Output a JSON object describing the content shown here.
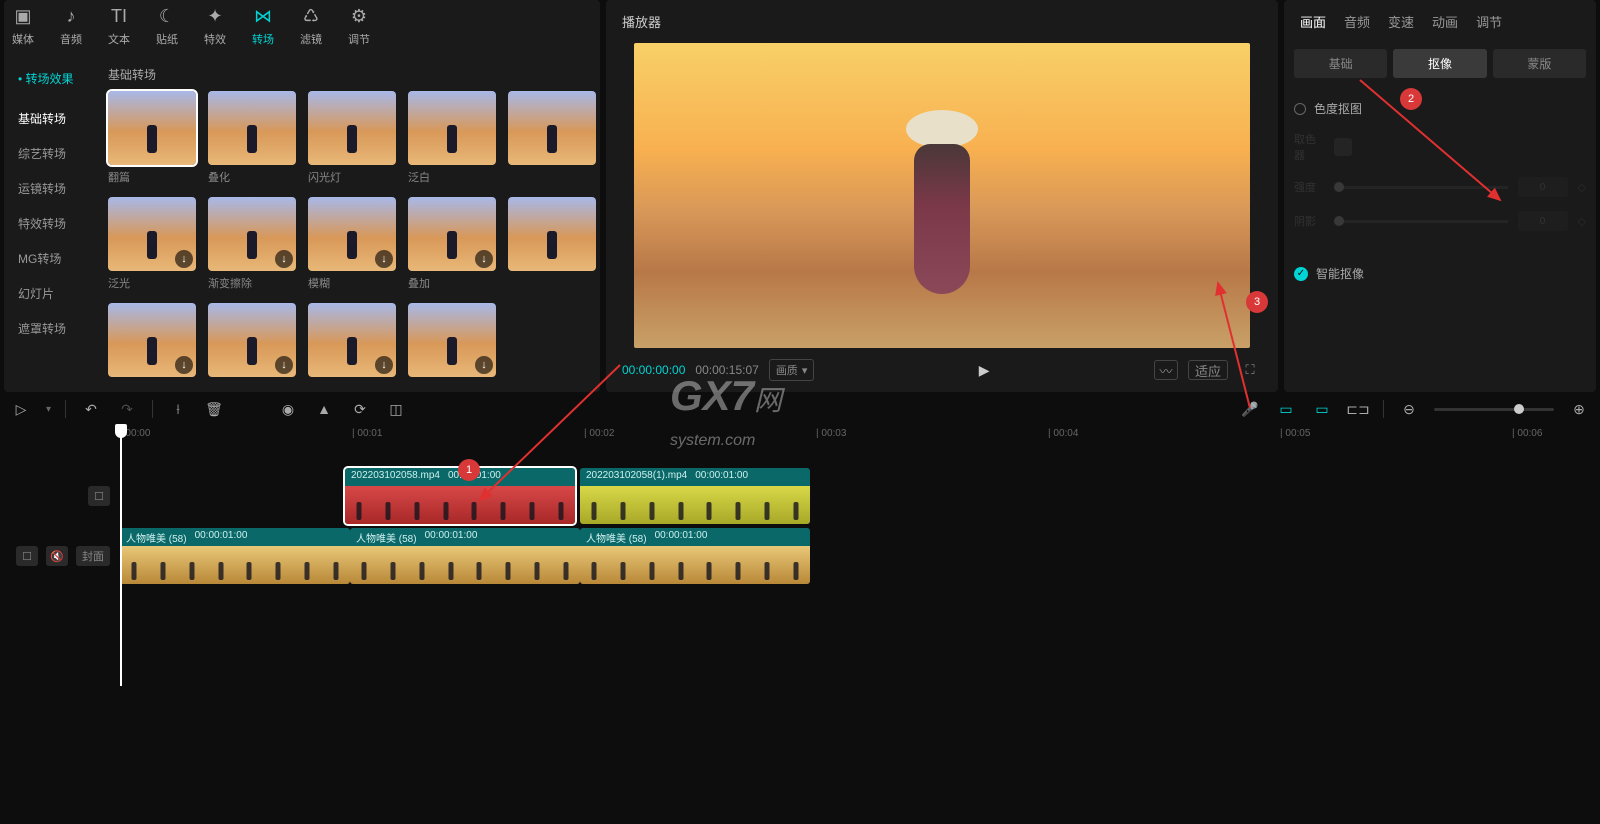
{
  "topTabs": [
    {
      "label": "媒体",
      "active": false
    },
    {
      "label": "音频",
      "active": false
    },
    {
      "label": "文本",
      "active": false
    },
    {
      "label": "贴纸",
      "active": false
    },
    {
      "label": "特效",
      "active": false
    },
    {
      "label": "转场",
      "active": true
    },
    {
      "label": "滤镜",
      "active": false
    },
    {
      "label": "调节",
      "active": false
    }
  ],
  "sideTitle": "转场效果",
  "sideCats": [
    {
      "label": "基础转场",
      "active": true
    },
    {
      "label": "综艺转场",
      "active": false
    },
    {
      "label": "运镜转场",
      "active": false
    },
    {
      "label": "特效转场",
      "active": false
    },
    {
      "label": "MG转场",
      "active": false
    },
    {
      "label": "幻灯片",
      "active": false
    },
    {
      "label": "遮罩转场",
      "active": false
    }
  ],
  "gridTitle": "基础转场",
  "gridItems": [
    {
      "label": "翻篇",
      "sel": true,
      "dl": false
    },
    {
      "label": "叠化",
      "sel": false,
      "dl": false
    },
    {
      "label": "闪光灯",
      "sel": false,
      "dl": false
    },
    {
      "label": "泛白",
      "sel": false,
      "dl": false
    },
    {
      "label": "",
      "sel": false,
      "dl": false
    },
    {
      "label": "泛光",
      "sel": false,
      "dl": true
    },
    {
      "label": "渐变擦除",
      "sel": false,
      "dl": true
    },
    {
      "label": "模糊",
      "sel": false,
      "dl": true
    },
    {
      "label": "叠加",
      "sel": false,
      "dl": true
    },
    {
      "label": "",
      "sel": false,
      "dl": false
    },
    {
      "label": "",
      "sel": false,
      "dl": true
    },
    {
      "label": "",
      "sel": false,
      "dl": true
    },
    {
      "label": "",
      "sel": false,
      "dl": true
    },
    {
      "label": "",
      "sel": false,
      "dl": true
    },
    {
      "label": "",
      "sel": false,
      "dl": false
    }
  ],
  "player": {
    "title": "播放器",
    "current": "00:00:00:00",
    "duration": "00:00:15:07",
    "ratioLabel": "画质",
    "fitLabel": "适应"
  },
  "rightTabs": [
    {
      "label": "画面",
      "active": true
    },
    {
      "label": "音频",
      "active": false
    },
    {
      "label": "变速",
      "active": false
    },
    {
      "label": "动画",
      "active": false
    },
    {
      "label": "调节",
      "active": false
    }
  ],
  "subTabs": [
    {
      "label": "基础",
      "active": false
    },
    {
      "label": "抠像",
      "active": true
    },
    {
      "label": "蒙版",
      "active": false
    }
  ],
  "chromakey": {
    "label": "色度抠图",
    "s1": "强度",
    "s2": "阴影",
    "v1": "0",
    "v2": "0"
  },
  "smartCutout": {
    "label": "智能抠像"
  },
  "ruler": [
    "00:00",
    "00:01",
    "00:02",
    "00:03",
    "00:04",
    "00:05",
    "00:06"
  ],
  "clips": {
    "top1": {
      "name": "202203102058.mp4",
      "dur": "00:00:01:00"
    },
    "top2": {
      "name": "202203102058(1).mp4",
      "dur": "00:00:01:00"
    },
    "bot": {
      "name": "人物唯美 (58)",
      "dur": "00:00:01:00"
    }
  },
  "coverLabel": "封面",
  "annotations": {
    "a1": "1",
    "a2": "2",
    "a3": "3"
  },
  "watermark": {
    "big": "GX7",
    "small": "网",
    "sub": "system.com"
  }
}
